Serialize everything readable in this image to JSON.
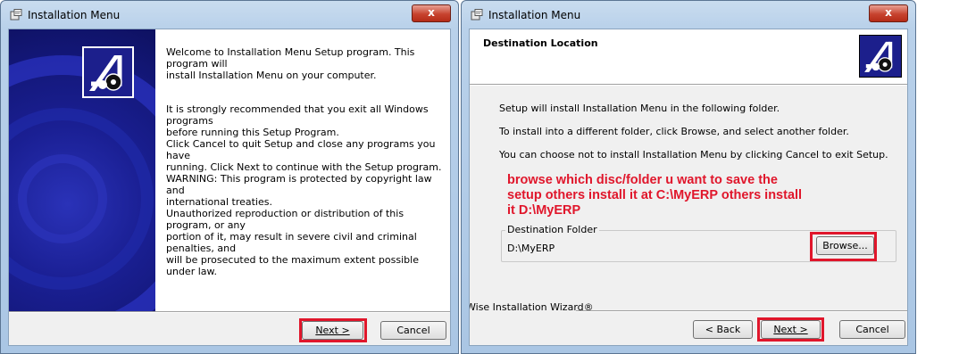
{
  "left_window": {
    "title": "Installation Menu",
    "close_label": "x",
    "paragraphs": [
      "Welcome to Installation Menu Setup program. This program will\ninstall Installation Menu on your computer.",
      "It is strongly recommended that you exit all Windows programs\nbefore running this Setup Program.",
      "Click Cancel to quit Setup and close any programs you have\nrunning.  Click Next to continue with the Setup program.",
      "WARNING: This program is protected by copyright law and\ninternational treaties.",
      "Unauthorized reproduction or distribution of this program, or any\nportion of it, may result in severe civil and criminal penalties, and\nwill be prosecuted to the maximum extent possible under law."
    ],
    "next_label": "Next >",
    "cancel_label": "Cancel"
  },
  "right_window": {
    "title": "Installation Menu",
    "close_label": "x",
    "header_title": "Destination Location",
    "lines": [
      "Setup will install Installation Menu in the following folder.",
      "To install into a different folder, click Browse, and select another folder.",
      "You can choose not to install Installation Menu by clicking Cancel to exit Setup."
    ],
    "annotation": "browse which disc/folder u want to save the\nsetup others install it at C:\\MyERP others install\nit D:\\MyERP",
    "group_label": "Destination Folder",
    "folder_path": "D:\\MyERP",
    "browse_label": "Browse...",
    "brand": "Wise Installation Wizard®",
    "back_label": "< Back",
    "next_label": "Next >",
    "cancel_label": "Cancel"
  },
  "colors": {
    "highlight": "#e0162b",
    "banner": "#1a1f93"
  },
  "icons": [
    "installer-app-icon",
    "close-icon",
    "disc-logo-icon"
  ]
}
